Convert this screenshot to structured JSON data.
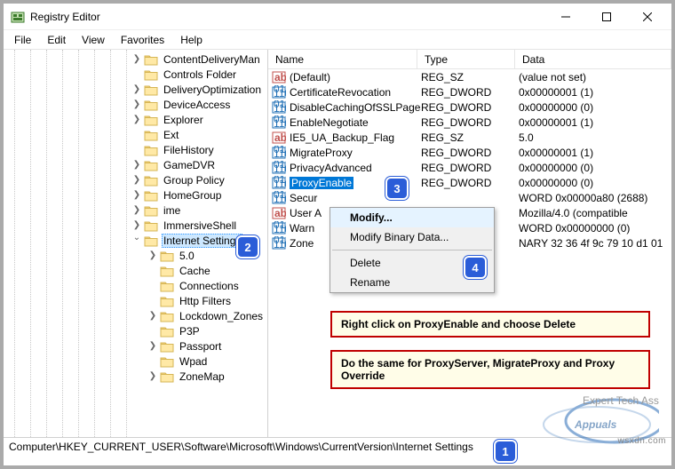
{
  "window": {
    "title": "Registry Editor"
  },
  "menu": {
    "file": "File",
    "edit": "Edit",
    "view": "View",
    "favorites": "Favorites",
    "help": "Help"
  },
  "tree": {
    "items": [
      {
        "depth": 8,
        "exp": ">",
        "label": "ContentDeliveryMan"
      },
      {
        "depth": 8,
        "exp": "",
        "label": "Controls Folder"
      },
      {
        "depth": 8,
        "exp": ">",
        "label": "DeliveryOptimization"
      },
      {
        "depth": 8,
        "exp": ">",
        "label": "DeviceAccess"
      },
      {
        "depth": 8,
        "exp": ">",
        "label": "Explorer"
      },
      {
        "depth": 8,
        "exp": "",
        "label": "Ext"
      },
      {
        "depth": 8,
        "exp": "",
        "label": "FileHistory"
      },
      {
        "depth": 8,
        "exp": ">",
        "label": "GameDVR"
      },
      {
        "depth": 8,
        "exp": ">",
        "label": "Group Policy"
      },
      {
        "depth": 8,
        "exp": ">",
        "label": "HomeGroup"
      },
      {
        "depth": 8,
        "exp": ">",
        "label": "ime"
      },
      {
        "depth": 8,
        "exp": ">",
        "label": "ImmersiveShell"
      },
      {
        "depth": 8,
        "exp": "v",
        "label": "Internet Settings",
        "selected": true
      },
      {
        "depth": 9,
        "exp": ">",
        "label": "5.0"
      },
      {
        "depth": 9,
        "exp": "",
        "label": "Cache"
      },
      {
        "depth": 9,
        "exp": "",
        "label": "Connections"
      },
      {
        "depth": 9,
        "exp": "",
        "label": "Http Filters"
      },
      {
        "depth": 9,
        "exp": ">",
        "label": "Lockdown_Zones"
      },
      {
        "depth": 9,
        "exp": "",
        "label": "P3P"
      },
      {
        "depth": 9,
        "exp": ">",
        "label": "Passport"
      },
      {
        "depth": 9,
        "exp": "",
        "label": "Wpad"
      },
      {
        "depth": 9,
        "exp": ">",
        "label": "ZoneMap"
      }
    ]
  },
  "columns": {
    "name": "Name",
    "type": "Type",
    "data": "Data"
  },
  "values": [
    {
      "icon": "sz",
      "name": "(Default)",
      "type": "REG_SZ",
      "data": "(value not set)"
    },
    {
      "icon": "dw",
      "name": "CertificateRevocation",
      "type": "REG_DWORD",
      "data": "0x00000001 (1)"
    },
    {
      "icon": "dw",
      "name": "DisableCachingOfSSLPages",
      "type": "REG_DWORD",
      "data": "0x00000000 (0)"
    },
    {
      "icon": "dw",
      "name": "EnableNegotiate",
      "type": "REG_DWORD",
      "data": "0x00000001 (1)"
    },
    {
      "icon": "sz",
      "name": "IE5_UA_Backup_Flag",
      "type": "REG_SZ",
      "data": "5.0"
    },
    {
      "icon": "dw",
      "name": "MigrateProxy",
      "type": "REG_DWORD",
      "data": "0x00000001 (1)"
    },
    {
      "icon": "dw",
      "name": "PrivacyAdvanced",
      "type": "REG_DWORD",
      "data": "0x00000000 (0)"
    },
    {
      "icon": "dw",
      "name": "ProxyEnable",
      "type": "REG_DWORD",
      "data": "0x00000000 (0)",
      "selected": true
    },
    {
      "icon": "dw",
      "name": "Secur",
      "type": "",
      "data": "WORD        0x00000a80 (2688)",
      "partial": true
    },
    {
      "icon": "sz",
      "name": "User A",
      "type": "",
      "data": "                  Mozilla/4.0 (compatible",
      "partial": true
    },
    {
      "icon": "dw",
      "name": "Warn",
      "type": "",
      "data": "WORD        0x00000000 (0)",
      "partial": true
    },
    {
      "icon": "dw",
      "name": "Zone",
      "type": "",
      "data": "NARY         32 36 4f 9c 79 10 d1 01",
      "partial": true
    }
  ],
  "context": {
    "modify": "Modify...",
    "modify_binary": "Modify Binary Data...",
    "delete": "Delete",
    "rename": "Rename"
  },
  "notes": {
    "a": "Right click on ProxyEnable and choose Delete",
    "b": "Do the same for ProxyServer, MigrateProxy and Proxy Override"
  },
  "status": {
    "path": "Computer\\HKEY_CURRENT_USER\\Software\\Microsoft\\Windows\\CurrentVersion\\Internet Settings"
  },
  "badges": {
    "b1": "1",
    "b2": "2",
    "b3": "3",
    "b4": "4"
  },
  "logo_text": "Appuals",
  "logo_sub": "Expert Tech Assistance!",
  "watermark": "wsxdn.com"
}
